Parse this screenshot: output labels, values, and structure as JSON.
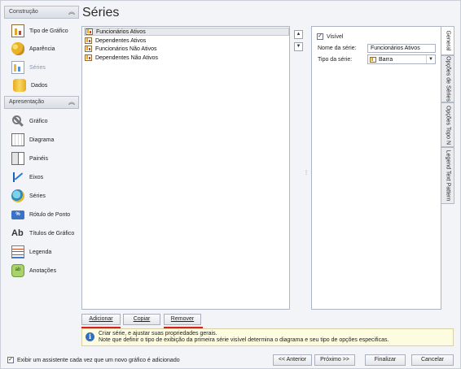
{
  "title": "Séries",
  "nav": {
    "group_construcao": "Construção",
    "group_apresentacao": "Apresentação",
    "construcao_items": [
      "Tipo de Gráfico",
      "Aparência",
      "Séries",
      "Dados"
    ],
    "apresentacao_items": [
      "Gráfico",
      "Diagrama",
      "Painéis",
      "Eixos",
      "Séries",
      "Rótulo de Ponto",
      "Títulos de Gráfico",
      "Legenda",
      "Anotações"
    ],
    "active_item": "Séries"
  },
  "series": {
    "items": [
      "Funcionários Ativos",
      "Dependentes Ativos",
      "Funcionários Não Ativos",
      "Dependentes Não Ativos"
    ],
    "selected": "Funcionários Ativos",
    "up_glyph": "▲",
    "down_glyph": "▼"
  },
  "properties": {
    "visible_label": "Visível",
    "visible_checked": true,
    "name_label": "Nome da série:",
    "name_value": "Funcionários Ativos",
    "type_label": "Tipo da série:",
    "type_value": "Barra"
  },
  "tabs": [
    "General",
    "Opções de Séries",
    "Opções Topo N",
    "Legend Text Pattern"
  ],
  "active_tab": "General",
  "buttons": {
    "add": "Adicionar",
    "copy": "Copiar",
    "remove": "Remover",
    "back": "<< Anterior",
    "next": "Próximo >>",
    "finish": "Finalizar",
    "cancel": "Cancelar"
  },
  "info": {
    "line1": "Criar série, e ajustar suas propriedades gerais.",
    "line2": "Note que definir o tipo de exibição da primeira série visível determina o diagrama e seu tipo de opções especificas."
  },
  "footer": {
    "checkbox_label": "Exibir um assistente cada vez que um novo gráfico é adicionado",
    "checked": true
  },
  "colors": {
    "highlight_underline": "#d21f1f",
    "info_background": "#fdfbe0",
    "info_icon": "#2d6fc4"
  }
}
